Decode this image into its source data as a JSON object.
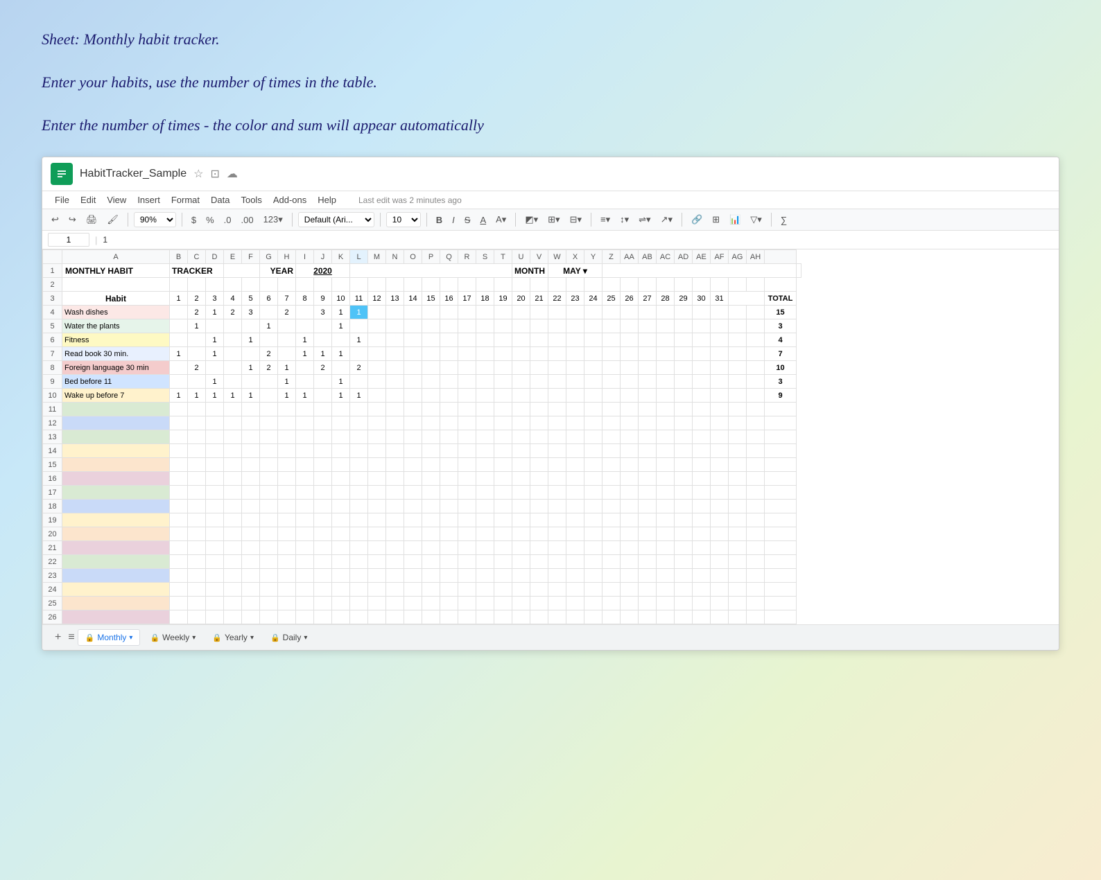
{
  "intro": {
    "line1": "Sheet: Monthly habit tracker.",
    "line2": "Enter your habits, use the number of times in the table.",
    "line3": "Enter the number of times - the color and sum will appear automatically"
  },
  "title_bar": {
    "file_name": "HabitTracker_Sample",
    "star": "☆",
    "copy": "⊡",
    "cloud": "☁"
  },
  "menu": {
    "items": [
      "File",
      "Edit",
      "View",
      "Insert",
      "Format",
      "Data",
      "Tools",
      "Add-ons",
      "Help"
    ],
    "last_edit": "Last edit was 2 minutes ago"
  },
  "toolbar": {
    "zoom": "90%",
    "font": "Default (Ari...",
    "font_size": "10"
  },
  "formula_bar": {
    "cell_ref": "1"
  },
  "sheet": {
    "title": "MONTHLY HABIT TRACKER",
    "year_label": "YEAR",
    "year_value": "2020",
    "month_label": "MONTH",
    "month_value": "MAY ▾",
    "habit_col_header": "Habit",
    "total_header": "TOTAL",
    "days": [
      1,
      2,
      3,
      4,
      5,
      6,
      7,
      8,
      9,
      10,
      11,
      12,
      13,
      14,
      15,
      16,
      17,
      18,
      19,
      20,
      21,
      22,
      23,
      24,
      25,
      26,
      27,
      28,
      29,
      30,
      31
    ],
    "rows": [
      {
        "name": "Wash dishes",
        "color": "#fce8e6",
        "data": [
          null,
          2,
          1,
          2,
          3,
          null,
          2,
          null,
          3,
          1,
          1,
          null,
          null,
          null,
          null,
          null,
          null,
          null,
          null,
          null,
          null,
          null,
          null,
          null,
          null,
          null,
          null,
          null,
          null,
          null,
          null
        ],
        "total": 15,
        "rowClass": "row-wash"
      },
      {
        "name": "Water the plants",
        "color": "#e6f4ea",
        "data": [
          null,
          1,
          null,
          null,
          null,
          1,
          null,
          null,
          null,
          1,
          null,
          null,
          null,
          null,
          null,
          null,
          null,
          null,
          null,
          null,
          null,
          null,
          null,
          null,
          null,
          null,
          null,
          null,
          null,
          null,
          null
        ],
        "total": 3,
        "rowClass": "row-water"
      },
      {
        "name": "Fitness",
        "color": "#fef9c3",
        "data": [
          null,
          null,
          1,
          null,
          1,
          null,
          null,
          1,
          null,
          null,
          1,
          null,
          null,
          null,
          null,
          null,
          null,
          null,
          null,
          null,
          null,
          null,
          null,
          null,
          null,
          null,
          null,
          null,
          null,
          null,
          null
        ],
        "total": 4,
        "rowClass": "row-fitness"
      },
      {
        "name": "Read book 30 min.",
        "color": "#e8f0fe",
        "data": [
          1,
          null,
          1,
          null,
          null,
          2,
          null,
          1,
          1,
          1,
          null,
          null,
          null,
          null,
          null,
          null,
          null,
          null,
          null,
          null,
          null,
          null,
          null,
          null,
          null,
          null,
          null,
          null,
          null,
          null,
          null
        ],
        "total": 7,
        "rowClass": "row-readbook"
      },
      {
        "name": "Foreign language 30 min",
        "color": "#f4cccc",
        "data": [
          null,
          2,
          null,
          null,
          1,
          2,
          1,
          null,
          2,
          null,
          2,
          null,
          null,
          null,
          null,
          null,
          null,
          null,
          null,
          null,
          null,
          null,
          null,
          null,
          null,
          null,
          null,
          null,
          null,
          null,
          null
        ],
        "total": 10,
        "rowClass": "row-foreign"
      },
      {
        "name": "Bed before 11",
        "color": "#d0e4ff",
        "data": [
          null,
          null,
          1,
          null,
          null,
          null,
          1,
          null,
          null,
          1,
          null,
          null,
          null,
          null,
          null,
          null,
          null,
          null,
          null,
          null,
          null,
          null,
          null,
          null,
          null,
          null,
          null,
          null,
          null,
          null,
          null
        ],
        "total": 3,
        "rowClass": "row-bed"
      },
      {
        "name": "Wake up before 7",
        "color": "#fff2cc",
        "data": [
          1,
          1,
          1,
          1,
          1,
          null,
          1,
          1,
          null,
          1,
          1,
          null,
          null,
          null,
          null,
          null,
          null,
          null,
          null,
          null,
          null,
          null,
          null,
          null,
          null,
          null,
          null,
          null,
          null,
          null,
          null
        ],
        "total": 9,
        "rowClass": "row-wakeup"
      }
    ],
    "empty_row_classes": [
      "row-empty1",
      "row-empty2",
      "row-empty1",
      "row-empty3",
      "row-empty4",
      "row-empty5",
      "row-empty6",
      "row-empty7",
      "row-empty8",
      "row-empty9",
      "row-empty10",
      "row-empty1",
      "row-empty2",
      "row-empty3",
      "row-empty4",
      "row-empty5"
    ],
    "col_headers": [
      "A",
      "B",
      "C",
      "D",
      "E",
      "F",
      "G",
      "H",
      "I",
      "J",
      "K",
      "L",
      "M",
      "N",
      "O",
      "P",
      "Q",
      "R",
      "S",
      "T",
      "U",
      "V",
      "W",
      "X",
      "Y",
      "Z",
      "AA",
      "AB",
      "AC",
      "AD",
      "AE",
      "AF",
      "AG",
      "AH"
    ]
  },
  "tabs": {
    "items": [
      {
        "label": "Monthly",
        "active": true
      },
      {
        "label": "Weekly",
        "active": false
      },
      {
        "label": "Yearly",
        "active": false
      },
      {
        "label": "Daily",
        "active": false
      }
    ]
  }
}
